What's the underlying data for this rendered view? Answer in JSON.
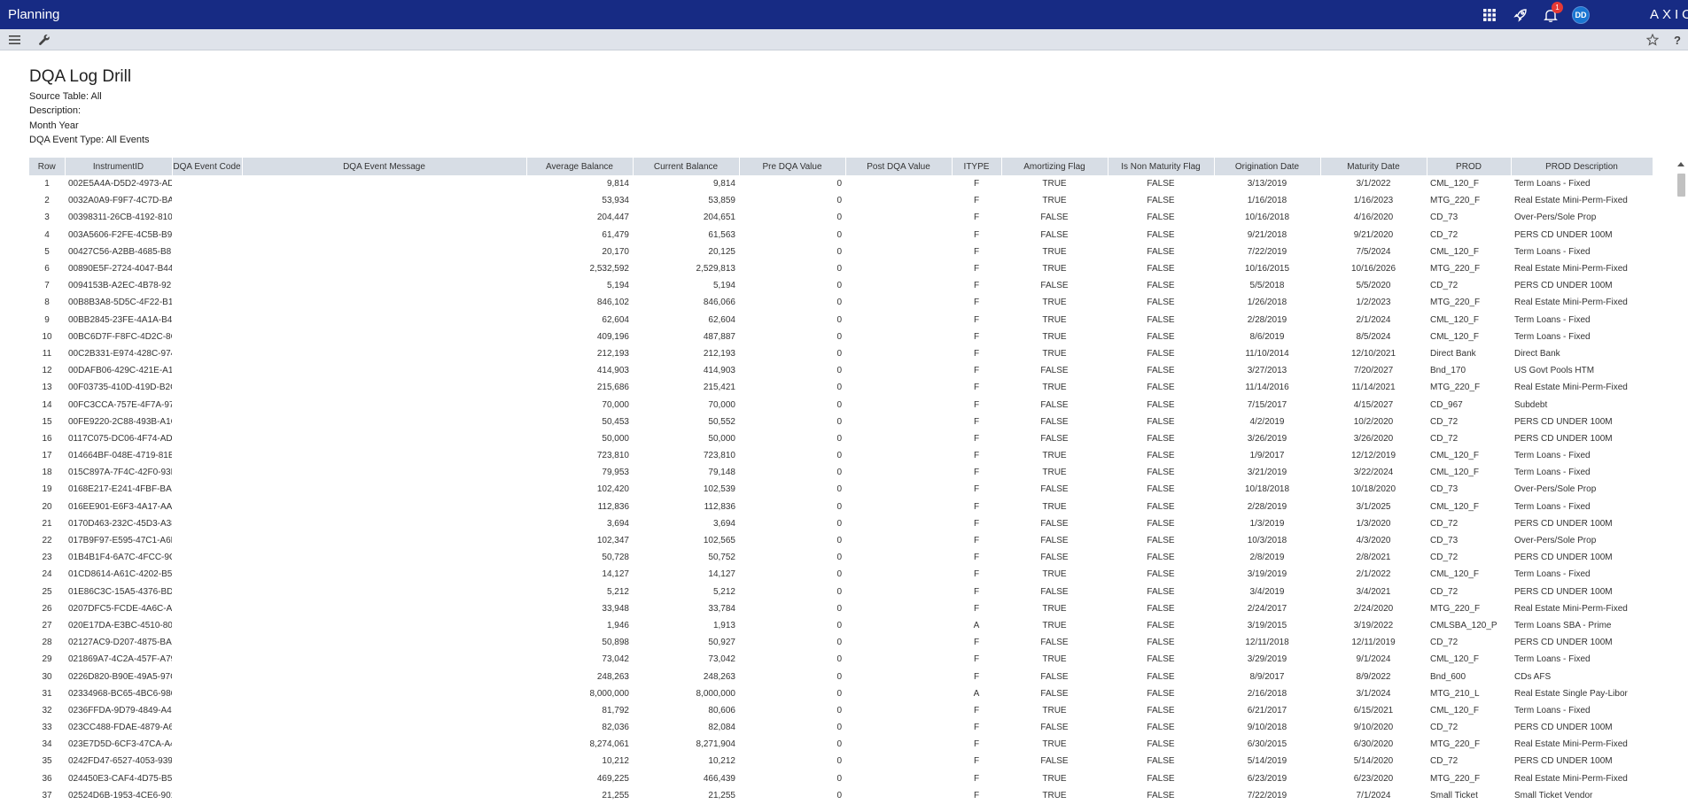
{
  "app": {
    "title": "Planning",
    "notification_count": "1",
    "user_initials": "DD",
    "brand": "AXIOM"
  },
  "icons": {
    "apps": "apps-grid-icon",
    "launch": "rocket-icon",
    "notifications": "bell-icon",
    "menu": "hamburger-menu-icon",
    "tools": "wrench-icon",
    "favorite": "star-icon",
    "help": "help-icon"
  },
  "report": {
    "title": "DQA Log Drill",
    "source_table": "Source Table: All",
    "description": "Description:",
    "month_year": "Month Year",
    "event_type": "DQA Event Type: All Events"
  },
  "columns": [
    "Row",
    "InstrumentID",
    "DQA Event Code",
    "DQA Event Message",
    "Average Balance",
    "Current Balance",
    "Pre DQA Value",
    "Post DQA Value",
    "ITYPE",
    "Amortizing Flag",
    "Is Non Maturity Flag",
    "Origination Date",
    "Maturity Date",
    "PROD",
    "PROD Description"
  ],
  "rows": [
    [
      "1",
      "002E5A4A-D5D2-4973-AD3",
      "",
      "",
      "9,814",
      "9,814",
      "0",
      "",
      "F",
      "TRUE",
      "FALSE",
      "3/13/2019",
      "3/1/2022",
      "CML_120_F",
      "Term Loans - Fixed"
    ],
    [
      "2",
      "0032A0A9-F9F7-4C7D-BA2",
      "",
      "",
      "53,934",
      "53,859",
      "0",
      "",
      "F",
      "TRUE",
      "FALSE",
      "1/16/2018",
      "1/16/2023",
      "MTG_220_F",
      "Real Estate Mini-Perm-Fixed"
    ],
    [
      "3",
      "00398311-26CB-4192-8106",
      "",
      "",
      "204,447",
      "204,651",
      "0",
      "",
      "F",
      "FALSE",
      "FALSE",
      "10/16/2018",
      "4/16/2020",
      "CD_73",
      "Over-Pers/Sole Prop"
    ],
    [
      "4",
      "003A5606-F2FE-4C5B-B9E",
      "",
      "",
      "61,479",
      "61,563",
      "0",
      "",
      "F",
      "FALSE",
      "FALSE",
      "9/21/2018",
      "9/21/2020",
      "CD_72",
      "PERS CD UNDER 100M"
    ],
    [
      "5",
      "00427C56-A2BB-4685-B8B",
      "",
      "",
      "20,170",
      "20,125",
      "0",
      "",
      "F",
      "TRUE",
      "FALSE",
      "7/22/2019",
      "7/5/2024",
      "CML_120_F",
      "Term Loans - Fixed"
    ],
    [
      "6",
      "00890E5F-2724-4047-B445",
      "",
      "",
      "2,532,592",
      "2,529,813",
      "0",
      "",
      "F",
      "TRUE",
      "FALSE",
      "10/16/2015",
      "10/16/2026",
      "MTG_220_F",
      "Real Estate Mini-Perm-Fixed"
    ],
    [
      "7",
      "0094153B-A2EC-4B78-92E",
      "",
      "",
      "5,194",
      "5,194",
      "0",
      "",
      "F",
      "FALSE",
      "FALSE",
      "5/5/2018",
      "5/5/2020",
      "CD_72",
      "PERS CD UNDER 100M"
    ],
    [
      "8",
      "00B8B3A8-5D5C-4F22-B18",
      "",
      "",
      "846,102",
      "846,066",
      "0",
      "",
      "F",
      "TRUE",
      "FALSE",
      "1/26/2018",
      "1/2/2023",
      "MTG_220_F",
      "Real Estate Mini-Perm-Fixed"
    ],
    [
      "9",
      "00BB2845-23FE-4A1A-B44",
      "",
      "",
      "62,604",
      "62,604",
      "0",
      "",
      "F",
      "TRUE",
      "FALSE",
      "2/28/2019",
      "2/1/2024",
      "CML_120_F",
      "Term Loans - Fixed"
    ],
    [
      "10",
      "00BC6D7F-F8FC-4D2C-8C3",
      "",
      "",
      "409,196",
      "487,887",
      "0",
      "",
      "F",
      "TRUE",
      "FALSE",
      "8/6/2019",
      "8/5/2024",
      "CML_120_F",
      "Term Loans - Fixed"
    ],
    [
      "11",
      "00C2B331-E974-428C-9748",
      "",
      "",
      "212,193",
      "212,193",
      "0",
      "",
      "F",
      "TRUE",
      "FALSE",
      "11/10/2014",
      "12/10/2021",
      "Direct Bank",
      "Direct Bank"
    ],
    [
      "12",
      "00DAFB06-429C-421E-A19",
      "",
      "",
      "414,903",
      "414,903",
      "0",
      "",
      "F",
      "FALSE",
      "FALSE",
      "3/27/2013",
      "7/20/2027",
      "Bnd_170",
      "US Govt Pools HTM"
    ],
    [
      "13",
      "00F03735-410D-419D-B2C",
      "",
      "",
      "215,686",
      "215,421",
      "0",
      "",
      "F",
      "TRUE",
      "FALSE",
      "11/14/2016",
      "11/14/2021",
      "MTG_220_F",
      "Real Estate Mini-Perm-Fixed"
    ],
    [
      "14",
      "00FC3CCA-757E-4F7A-975",
      "",
      "",
      "70,000",
      "70,000",
      "0",
      "",
      "F",
      "FALSE",
      "FALSE",
      "7/15/2017",
      "4/15/2027",
      "CD_967",
      "Subdebt"
    ],
    [
      "15",
      "00FE9220-2C88-493B-A1C",
      "",
      "",
      "50,453",
      "50,552",
      "0",
      "",
      "F",
      "FALSE",
      "FALSE",
      "4/2/2019",
      "10/2/2020",
      "CD_72",
      "PERS CD UNDER 100M"
    ],
    [
      "16",
      "0117C075-DC06-4F74-AD8",
      "",
      "",
      "50,000",
      "50,000",
      "0",
      "",
      "F",
      "FALSE",
      "FALSE",
      "3/26/2019",
      "3/26/2020",
      "CD_72",
      "PERS CD UNDER 100M"
    ],
    [
      "17",
      "014664BF-048E-4719-81E",
      "",
      "",
      "723,810",
      "723,810",
      "0",
      "",
      "F",
      "TRUE",
      "FALSE",
      "1/9/2017",
      "12/12/2019",
      "CML_120_F",
      "Term Loans - Fixed"
    ],
    [
      "18",
      "015C897A-7F4C-42F0-93F",
      "",
      "",
      "79,953",
      "79,148",
      "0",
      "",
      "F",
      "TRUE",
      "FALSE",
      "3/21/2019",
      "3/22/2024",
      "CML_120_F",
      "Term Loans - Fixed"
    ],
    [
      "19",
      "0168E217-E241-4FBF-BAC",
      "",
      "",
      "102,420",
      "102,539",
      "0",
      "",
      "F",
      "FALSE",
      "FALSE",
      "10/18/2018",
      "10/18/2020",
      "CD_73",
      "Over-Pers/Sole Prop"
    ],
    [
      "20",
      "016EE901-E6F3-4A17-AA1",
      "",
      "",
      "112,836",
      "112,836",
      "0",
      "",
      "F",
      "TRUE",
      "FALSE",
      "2/28/2019",
      "3/1/2025",
      "CML_120_F",
      "Term Loans - Fixed"
    ],
    [
      "21",
      "0170D463-232C-45D3-A38",
      "",
      "",
      "3,694",
      "3,694",
      "0",
      "",
      "F",
      "FALSE",
      "FALSE",
      "1/3/2019",
      "1/3/2020",
      "CD_72",
      "PERS CD UNDER 100M"
    ],
    [
      "22",
      "017B9F97-E595-47C1-A6E",
      "",
      "",
      "102,347",
      "102,565",
      "0",
      "",
      "F",
      "FALSE",
      "FALSE",
      "10/3/2018",
      "4/3/2020",
      "CD_73",
      "Over-Pers/Sole Prop"
    ],
    [
      "23",
      "01B4B1F4-6A7C-4FCC-9C6",
      "",
      "",
      "50,728",
      "50,752",
      "0",
      "",
      "F",
      "FALSE",
      "FALSE",
      "2/8/2019",
      "2/8/2021",
      "CD_72",
      "PERS CD UNDER 100M"
    ],
    [
      "24",
      "01CD8614-A61C-4202-B5C",
      "",
      "",
      "14,127",
      "14,127",
      "0",
      "",
      "F",
      "TRUE",
      "FALSE",
      "3/19/2019",
      "2/1/2022",
      "CML_120_F",
      "Term Loans - Fixed"
    ],
    [
      "25",
      "01E86C3C-15A5-4376-BD9",
      "",
      "",
      "5,212",
      "5,212",
      "0",
      "",
      "F",
      "FALSE",
      "FALSE",
      "3/4/2019",
      "3/4/2021",
      "CD_72",
      "PERS CD UNDER 100M"
    ],
    [
      "26",
      "0207DFC5-FCDE-4A6C-AD",
      "",
      "",
      "33,948",
      "33,784",
      "0",
      "",
      "F",
      "TRUE",
      "FALSE",
      "2/24/2017",
      "2/24/2020",
      "MTG_220_F",
      "Real Estate Mini-Perm-Fixed"
    ],
    [
      "27",
      "020E17DA-E3BC-4510-804",
      "",
      "",
      "1,946",
      "1,913",
      "0",
      "",
      "A",
      "TRUE",
      "FALSE",
      "3/19/2015",
      "3/19/2022",
      "CMLSBA_120_P",
      "Term Loans SBA - Prime"
    ],
    [
      "28",
      "02127AC9-D207-4875-BAB",
      "",
      "",
      "50,898",
      "50,927",
      "0",
      "",
      "F",
      "FALSE",
      "FALSE",
      "12/11/2018",
      "12/11/2019",
      "CD_72",
      "PERS CD UNDER 100M"
    ],
    [
      "29",
      "021869A7-4C2A-457F-A79",
      "",
      "",
      "73,042",
      "73,042",
      "0",
      "",
      "F",
      "TRUE",
      "FALSE",
      "3/29/2019",
      "9/1/2024",
      "CML_120_F",
      "Term Loans - Fixed"
    ],
    [
      "30",
      "0226D820-B90E-49A5-97C",
      "",
      "",
      "248,263",
      "248,263",
      "0",
      "",
      "F",
      "FALSE",
      "FALSE",
      "8/9/2017",
      "8/9/2022",
      "Bnd_600",
      "CDs AFS"
    ],
    [
      "31",
      "02334968-BC65-4BC6-986",
      "",
      "",
      "8,000,000",
      "8,000,000",
      "0",
      "",
      "A",
      "FALSE",
      "FALSE",
      "2/16/2018",
      "3/1/2024",
      "MTG_210_L",
      "Real Estate Single Pay-Libor"
    ],
    [
      "32",
      "0236FFDA-9D79-4849-A41",
      "",
      "",
      "81,792",
      "80,606",
      "0",
      "",
      "F",
      "TRUE",
      "FALSE",
      "6/21/2017",
      "6/15/2021",
      "CML_120_F",
      "Term Loans - Fixed"
    ],
    [
      "33",
      "023CC488-FDAE-4879-A6A",
      "",
      "",
      "82,036",
      "82,084",
      "0",
      "",
      "F",
      "FALSE",
      "FALSE",
      "9/10/2018",
      "9/10/2020",
      "CD_72",
      "PERS CD UNDER 100M"
    ],
    [
      "34",
      "023E7D5D-6CF3-47CA-A4A",
      "",
      "",
      "8,274,061",
      "8,271,904",
      "0",
      "",
      "F",
      "TRUE",
      "FALSE",
      "6/30/2015",
      "6/30/2020",
      "MTG_220_F",
      "Real Estate Mini-Perm-Fixed"
    ],
    [
      "35",
      "0242FD47-6527-4053-939A",
      "",
      "",
      "10,212",
      "10,212",
      "0",
      "",
      "F",
      "FALSE",
      "FALSE",
      "5/14/2019",
      "5/14/2020",
      "CD_72",
      "PERS CD UNDER 100M"
    ],
    [
      "36",
      "024450E3-CAF4-4D75-B50",
      "",
      "",
      "469,225",
      "466,439",
      "0",
      "",
      "F",
      "TRUE",
      "FALSE",
      "6/23/2019",
      "6/23/2020",
      "MTG_220_F",
      "Real Estate Mini-Perm-Fixed"
    ],
    [
      "37",
      "02524D6B-1953-4CE6-901",
      "",
      "",
      "21,255",
      "21,255",
      "0",
      "",
      "F",
      "TRUE",
      "FALSE",
      "7/22/2019",
      "7/1/2024",
      "Small Ticket",
      "Small Ticket Vendor"
    ]
  ]
}
